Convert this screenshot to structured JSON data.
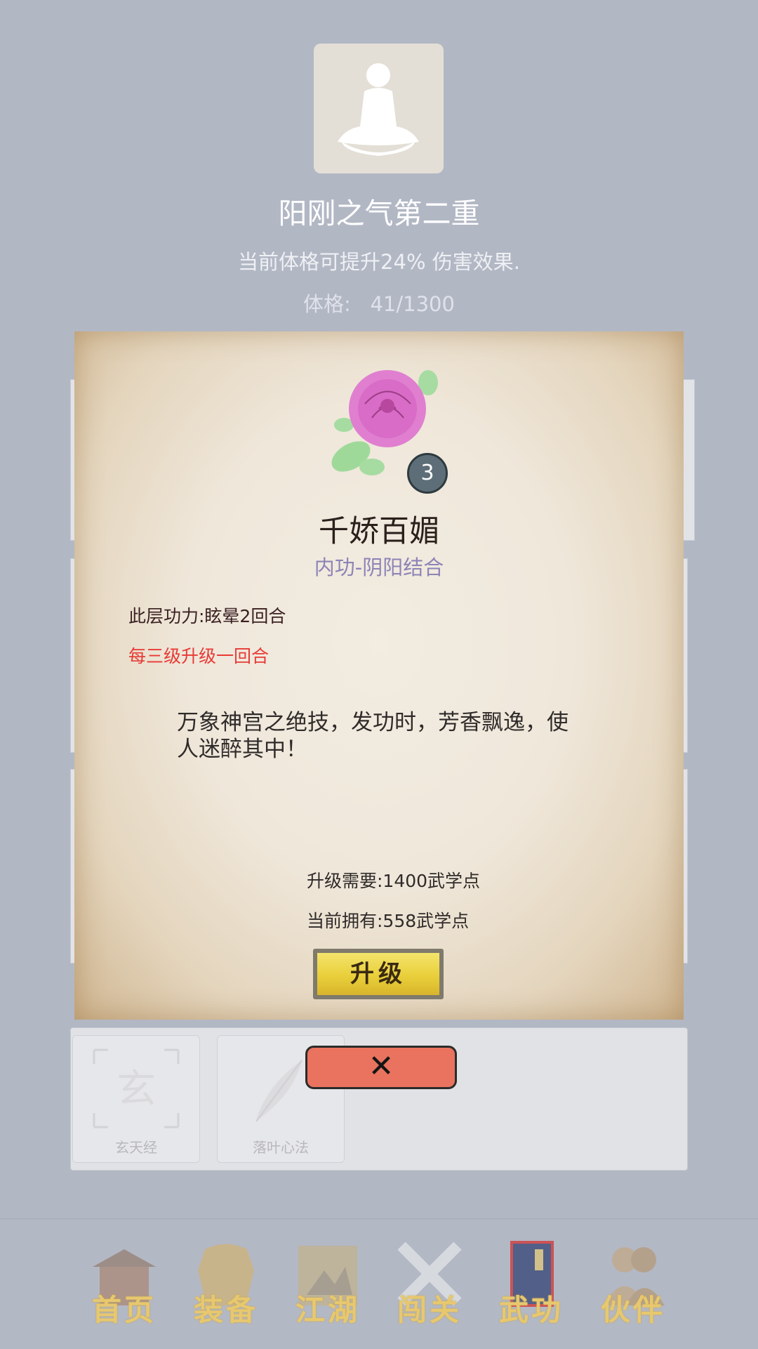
{
  "header": {
    "title": "阳刚之气第二重",
    "subtitle": "当前体格可提升24% 伤害效果.",
    "stat_label": "体格:",
    "stat_value": "41/1300",
    "avatar_icon": "meditation-icon"
  },
  "dialog": {
    "skill_name": "千娇百媚",
    "skill_type": "内功-阴阳结合",
    "level": "3",
    "icon": "rose-icon",
    "effect": "此层功力:眩晕2回合",
    "upgrade_note": "每三级升级一回合",
    "description": "万象神宫之绝技，发功时，芳香飘逸，使人迷醉其中！",
    "upgrade_cost": "升级需要:1400武学点",
    "current_points": "当前拥有:558武学点",
    "upgrade_button": "升级",
    "close_button": "✕"
  },
  "skills_list": [
    {
      "label": "玄天经",
      "icon": "xuan-seal-icon"
    },
    {
      "label": "落叶心法",
      "icon": "feather-icon"
    }
  ],
  "bottom_nav": [
    {
      "label": "首页",
      "icon": "palace-icon"
    },
    {
      "label": "装备",
      "icon": "armor-icon"
    },
    {
      "label": "江湖",
      "icon": "scroll-map-icon"
    },
    {
      "label": "闯关",
      "icon": "crossed-swords-icon"
    },
    {
      "label": "武功",
      "icon": "book-icon"
    },
    {
      "label": "伙伴",
      "icon": "partners-icon"
    }
  ],
  "colors": {
    "background": "#b2b7c4",
    "skill_type": "#8d84b6",
    "upgrade_note": "#e83a35",
    "upgrade_button": "#e9cf3a",
    "close_button": "#e9735e",
    "nav_text": "#e7c86f"
  }
}
